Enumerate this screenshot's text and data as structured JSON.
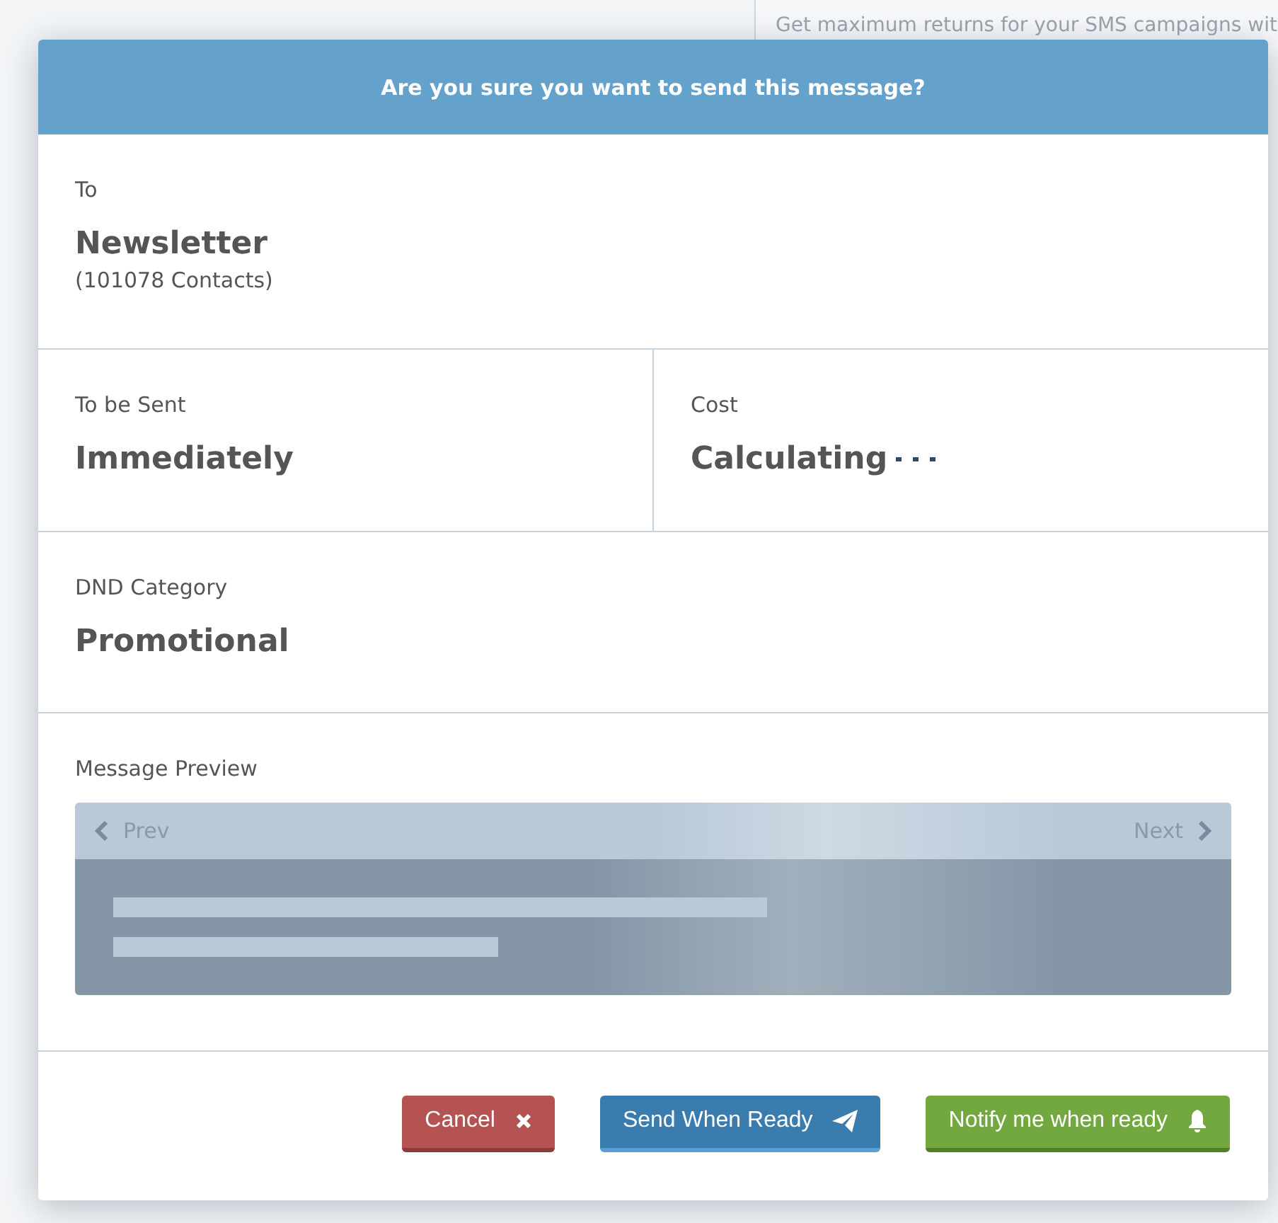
{
  "background": {
    "banner_text": "Get maximum returns for your SMS campaigns wit"
  },
  "dialog": {
    "title": "Are you sure you want to send this message?",
    "recipient": {
      "label": "To",
      "name": "Newsletter",
      "count": "(101078 Contacts)"
    },
    "schedule": {
      "label": "To be Sent",
      "value": "Immediately"
    },
    "cost": {
      "label": "Cost",
      "value": "Calculating",
      "loading": true
    },
    "dnd": {
      "label": "DND Category",
      "value": "Promotional"
    },
    "preview": {
      "label": "Message Preview",
      "prev": "Prev",
      "next": "Next",
      "loading": true
    },
    "buttons": [
      {
        "kind": "cancel",
        "label": "Cancel"
      },
      {
        "kind": "send",
        "label": "Send When Ready"
      },
      {
        "kind": "notify",
        "label": "Notify me when ready"
      }
    ]
  }
}
